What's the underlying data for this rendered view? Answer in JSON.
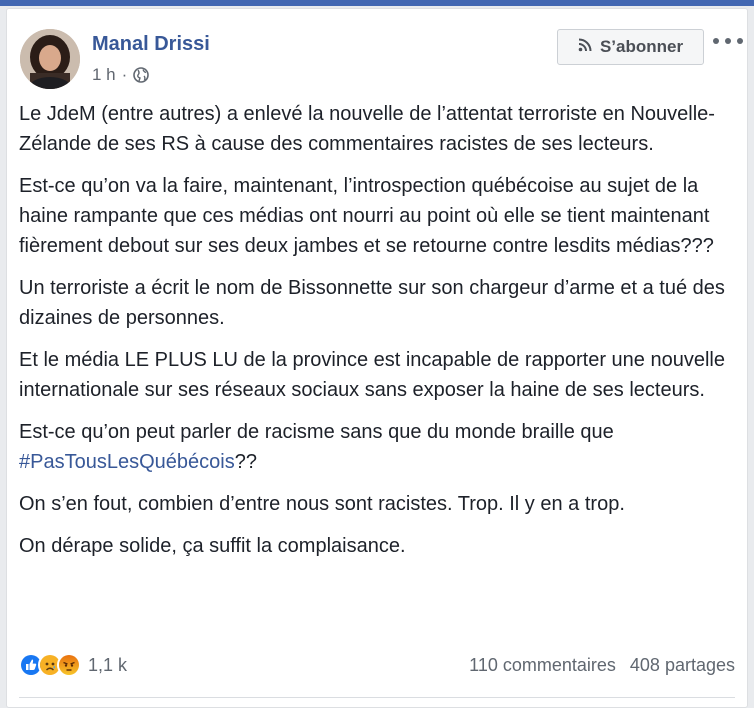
{
  "post": {
    "author": "Manal Drissi",
    "time": "1 h",
    "separator": "·",
    "follow_label": "S’abonner",
    "paragraphs": [
      "Le JdeM (entre autres) a enlevé la nouvelle de l’attentat terroriste en Nouvelle-Zélande de ses RS à cause des commentaires racistes de ses lecteurs.",
      "Est-ce qu’on va la faire, maintenant, l’introspection québécoise au sujet de la haine rampante que ces médias ont nourri au point où elle se tient maintenant fièrement debout sur ses deux jambes et se retourne contre lesdits médias???",
      "Un terroriste a écrit le nom de Bissonnette sur son chargeur d’arme et a tué des dizaines de personnes.",
      "Et le média LE PLUS LU de la province est incapable de rapporter une nouvelle internationale sur ses réseaux sociaux sans exposer la haine de ses lecteurs."
    ],
    "paragraph5_text": "Est-ce qu’on peut parler de racisme sans que du monde braille que",
    "hashtag": "#PasTousLesQuébécois",
    "paragraph5_suffix": "??",
    "paragraphs_end": [
      "On s’en fout, combien d’entre nous sont racistes. Trop. Il y en a trop.",
      "On dérape solide, ça suffit la complaisance."
    ],
    "reaction_count": "1,1 k",
    "comments": "110 commentaires",
    "shares": "408 partages"
  },
  "colors": {
    "link": "#385898",
    "like": "#1877f2",
    "sad": "#f7b125",
    "angry": "#e9710f"
  },
  "icons": [
    "rss-icon",
    "globe-icon",
    "more-dots-icon",
    "like-reaction-icon",
    "sad-reaction-icon",
    "angry-reaction-icon"
  ]
}
